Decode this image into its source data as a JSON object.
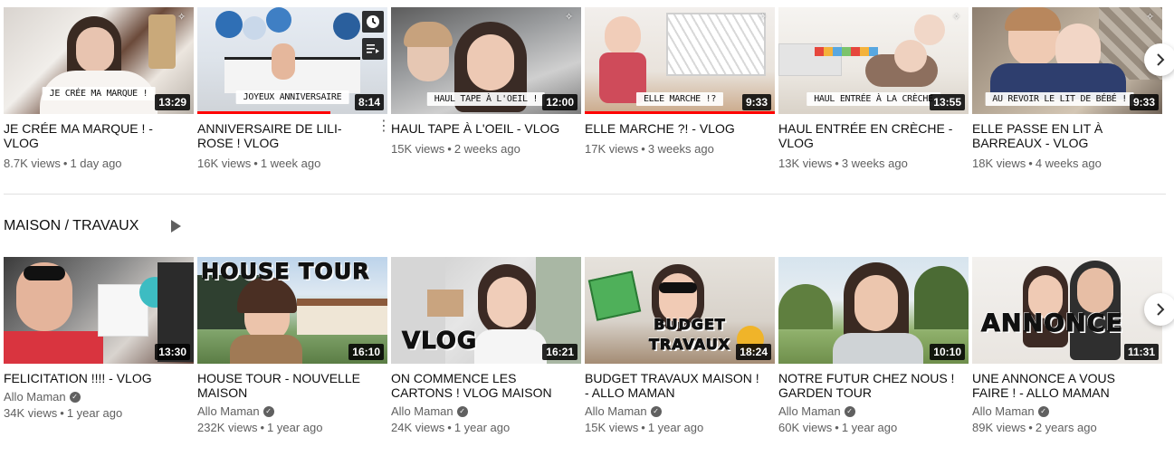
{
  "row1": {
    "videos": [
      {
        "title": "JE CRÉE MA MARQUE ! - VLOG",
        "overlay_text": "JE CRÉE MA MARQUE !",
        "duration": "13:29",
        "views": "8.7K views",
        "age": "1 day ago",
        "progress": 0
      },
      {
        "title": "ANNIVERSAIRE DE LILI-ROSE ! VLOG",
        "overlay_text": "JOYEUX ANNIVERSAIRE",
        "duration": "8:14",
        "views": "16K views",
        "age": "1 week ago",
        "progress": 0.7
      },
      {
        "title": "HAUL TAPE À L'OEIL - VLOG",
        "overlay_text": "HAUL TAPE À L'OEIL !",
        "duration": "12:00",
        "views": "15K views",
        "age": "2 weeks ago",
        "progress": 0
      },
      {
        "title": "ELLE MARCHE ?! - VLOG",
        "overlay_text": "ELLE MARCHE !?",
        "duration": "9:33",
        "views": "17K views",
        "age": "3 weeks ago",
        "progress": 1.0
      },
      {
        "title": "HAUL ENTRÉE EN CRÈCHE - VLOG",
        "overlay_text": "HAUL ENTRÉE À LA CRÈCHE",
        "duration": "13:55",
        "views": "13K views",
        "age": "3 weeks ago",
        "progress": 0
      },
      {
        "title": "ELLE PASSE EN LIT À BARREAUX - VLOG",
        "overlay_text": "AU REVOIR LE LIT DE BÉBÉ !",
        "duration": "9:33",
        "views": "18K views",
        "age": "4 weeks ago",
        "progress": 0
      }
    ]
  },
  "shelf2": {
    "title": "MAISON / TRAVAUX",
    "videos": [
      {
        "title": "FELICITATION !!!! - VLOG",
        "overlay_text": "",
        "duration": "13:30",
        "channel": "Allo Maman",
        "views": "34K views",
        "age": "1 year ago"
      },
      {
        "title": "HOUSE TOUR - NOUVELLE MAISON",
        "overlay_text": "HOUSE TOUR",
        "duration": "16:10",
        "channel": "Allo Maman",
        "views": "232K views",
        "age": "1 year ago"
      },
      {
        "title": "ON COMMENCE LES CARTONS ! VLOG MAISON",
        "overlay_text": "VLOG",
        "duration": "16:21",
        "channel": "Allo Maman",
        "views": "24K views",
        "age": "1 year ago"
      },
      {
        "title": "BUDGET TRAVAUX MAISON ! - ALLO MAMAN",
        "overlay_text": "BUDGET TRAVAUX",
        "duration": "18:24",
        "channel": "Allo Maman",
        "views": "15K views",
        "age": "1 year ago"
      },
      {
        "title": "NOTRE FUTUR CHEZ NOUS ! GARDEN TOUR",
        "overlay_text": "",
        "duration": "10:10",
        "channel": "Allo Maman",
        "views": "60K views",
        "age": "1 year ago"
      },
      {
        "title": "UNE ANNONCE A VOUS FAIRE ! - ALLO MAMAN",
        "overlay_text": "ANNONCE",
        "duration": "11:31",
        "channel": "Allo Maman",
        "views": "89K views",
        "age": "2 years ago"
      }
    ]
  },
  "icons": {
    "watch_later": "clock-icon",
    "add_to_queue": "queue-icon",
    "next": "chevron-right-icon",
    "more": "more-vert-icon",
    "play_all": "play-icon",
    "verified": "check-circle-icon"
  },
  "colors": {
    "progress": "#ff0000",
    "text_primary": "#0f0f0f",
    "text_secondary": "#606060"
  },
  "separator": "•"
}
